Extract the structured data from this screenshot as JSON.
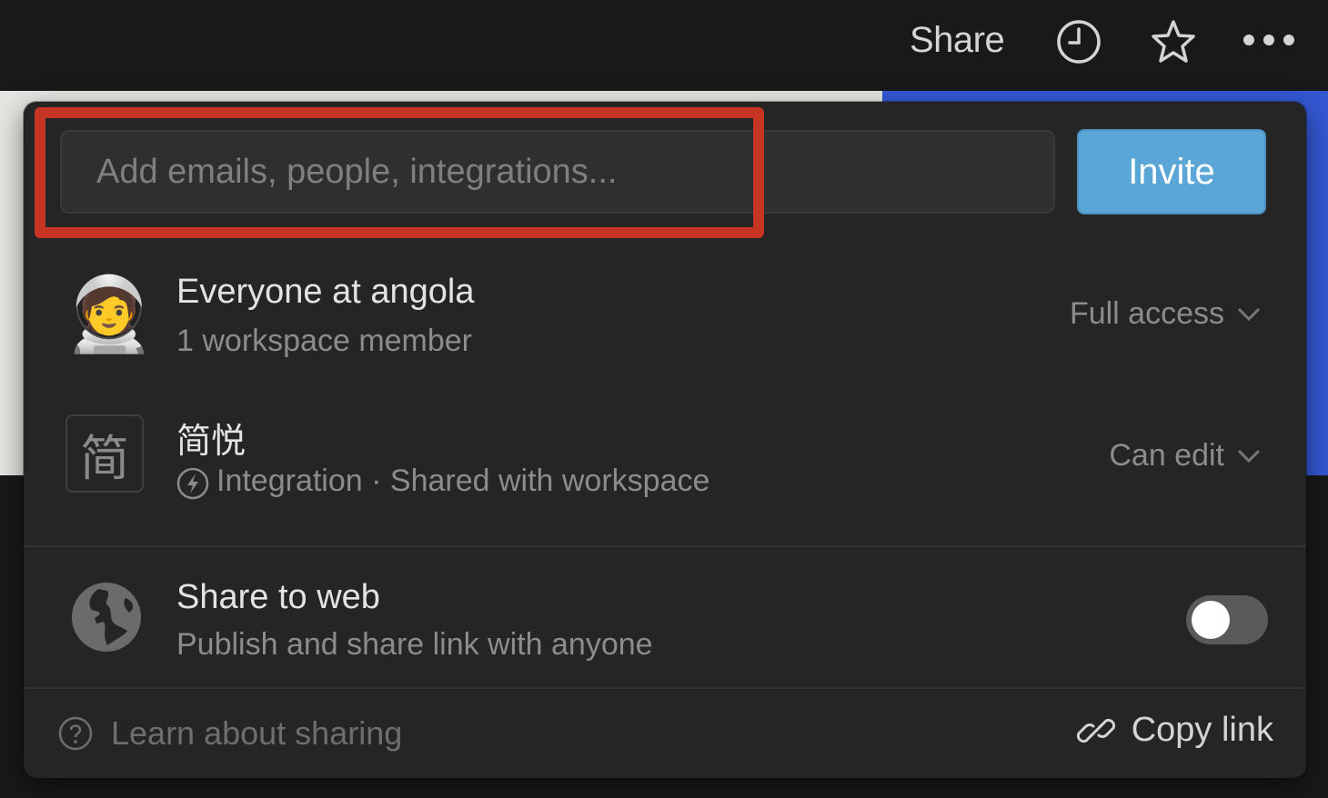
{
  "topbar": {
    "share_label": "Share",
    "icons": [
      "clock-icon",
      "star-icon",
      "more-icon"
    ]
  },
  "popup": {
    "search": {
      "placeholder": "Add emails, people, integrations...",
      "value": ""
    },
    "invite_label": "Invite",
    "members": [
      {
        "avatar": "🧑‍🚀",
        "name": "Everyone at angola",
        "subtitle": "1 workspace member",
        "permission": "Full access"
      },
      {
        "avatar": "简",
        "name": "简悦",
        "subtitle": "Integration · Shared with workspace",
        "permission": "Can edit"
      }
    ],
    "share_to_web": {
      "title": "Share to web",
      "subtitle": "Publish and share link with anyone",
      "enabled": false
    },
    "footer": {
      "learn_label": "Learn about sharing",
      "copy_link_label": "Copy link"
    }
  },
  "colors": {
    "accent": "#5aa6d6",
    "highlight": "#c63424",
    "background_blue": "#3358d4"
  }
}
